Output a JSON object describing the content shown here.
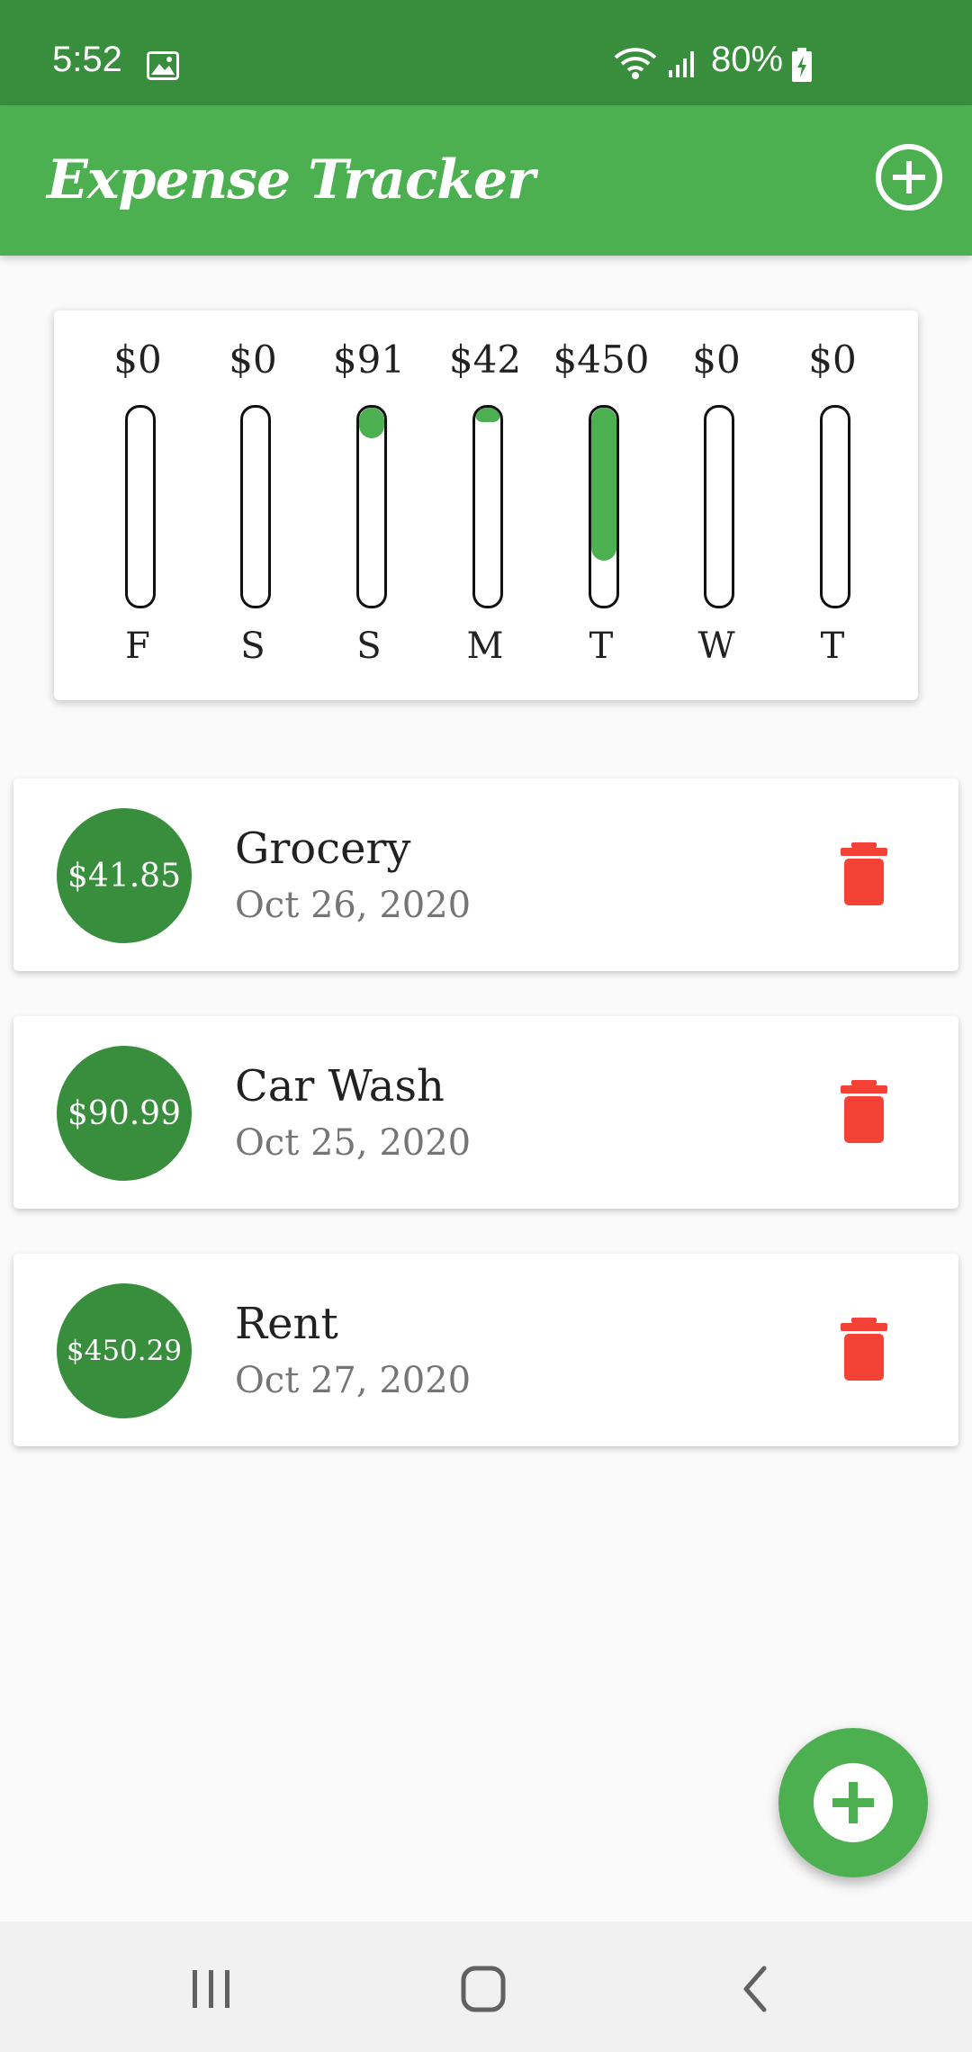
{
  "status_bar": {
    "time": "5:52",
    "battery": "80%",
    "icons": [
      "image-icon",
      "wifi-icon",
      "signal-icon",
      "battery-charging-icon"
    ]
  },
  "app_bar": {
    "title": "Expense Tracker",
    "add_icon": "add-circle-icon"
  },
  "chart": {
    "days": [
      {
        "day": "F",
        "amount": "$0",
        "fraction": 0
      },
      {
        "day": "S",
        "amount": "$0",
        "fraction": 0
      },
      {
        "day": "S",
        "amount": "$91",
        "fraction": 0.156
      },
      {
        "day": "M",
        "amount": "$42",
        "fraction": 0.072
      },
      {
        "day": "T",
        "amount": "$450",
        "fraction": 0.772
      },
      {
        "day": "W",
        "amount": "$0",
        "fraction": 0
      },
      {
        "day": "T",
        "amount": "$0",
        "fraction": 0
      }
    ]
  },
  "transactions": [
    {
      "amount": "$41.85",
      "title": "Grocery",
      "date": "Oct 26, 2020"
    },
    {
      "amount": "$90.99",
      "title": "Car Wash",
      "date": "Oct 25, 2020"
    },
    {
      "amount": "$450.29",
      "title": "Rent",
      "date": "Oct 27, 2020"
    }
  ],
  "colors": {
    "status_bar": "#388e3c",
    "app_bar": "#4caf50",
    "amount_circle": "#388e3c",
    "delete": "#f44336",
    "bar_fill": "#4caf50"
  },
  "nav": [
    "recent-apps-icon",
    "home-icon",
    "back-icon"
  ]
}
